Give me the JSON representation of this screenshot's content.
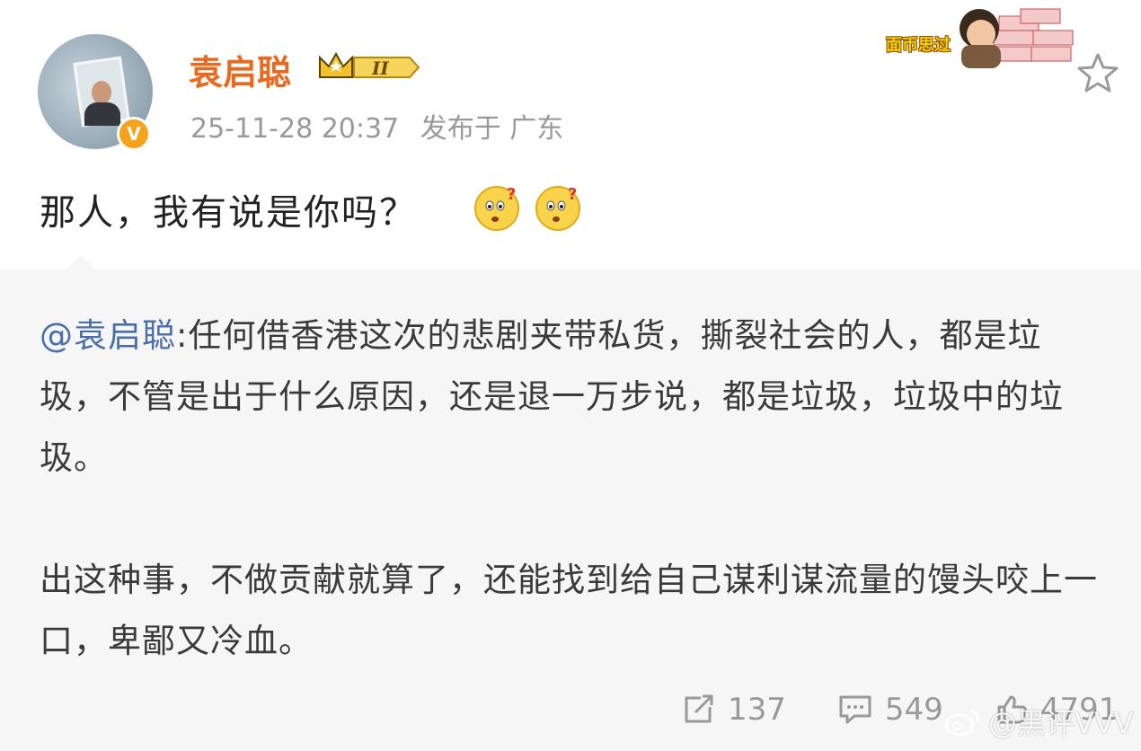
{
  "post": {
    "author": "袁启聪",
    "level_badge": "II",
    "timestamp": "25-11-28 20:37",
    "location": "发布于 广东",
    "content": "那人，我有说是你吗？",
    "emoji_names": [
      "thinking-face-icon",
      "thinking-face-icon"
    ]
  },
  "sticker": {
    "text": "面币思过"
  },
  "repost": {
    "mention": "@袁启聪",
    "paragraph1": ":任何借香港这次的悲剧夹带私货，撕裂社会的人，都是垃圾，不管是出于什么原因，还是退一万步说，都是垃圾，垃圾中的垃圾。",
    "paragraph2": "出这种事，不做贡献就算了，还能找到给自己谋利谋流量的馒头咬上一口，卑鄙又冷血。"
  },
  "actions": {
    "repost_count": "137",
    "comment_count": "549",
    "like_count": "4791"
  },
  "watermark": {
    "text": "@黑评VVV"
  },
  "colors": {
    "username": "#e86a1e",
    "mention": "#4a6fa8",
    "meta": "#999999",
    "repost_bg": "#f6f6f7"
  }
}
